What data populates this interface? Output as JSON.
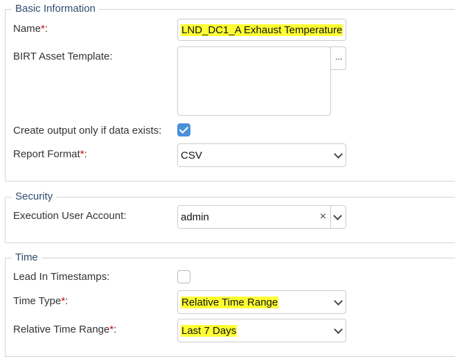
{
  "basic": {
    "legend": "Basic Information",
    "name_label": "Name",
    "name_value": "LND_DC1_A Exhaust Temperature",
    "birt_label": "BIRT Asset Template:",
    "browse_label": "···",
    "create_output_label": "Create output only if data exists:",
    "create_output_checked": true,
    "report_format_label": "Report Format",
    "report_format_value": "CSV"
  },
  "security": {
    "legend": "Security",
    "exec_user_label": "Execution User Account:",
    "exec_user_value": "admin",
    "clear_label": "×"
  },
  "time": {
    "legend": "Time",
    "lead_in_label": "Lead In Timestamps:",
    "lead_in_checked": false,
    "time_type_label": "Time Type",
    "time_type_value": "Relative Time Range",
    "relative_range_label": "Relative Time Range",
    "relative_range_value": "Last 7 Days"
  },
  "common": {
    "required_mark": "*",
    "colon": ":"
  },
  "colors": {
    "highlight": "#ffff33",
    "checkbox_accent": "#4a90d9",
    "legend_text": "#2e4d6d",
    "required": "#cc0000"
  }
}
